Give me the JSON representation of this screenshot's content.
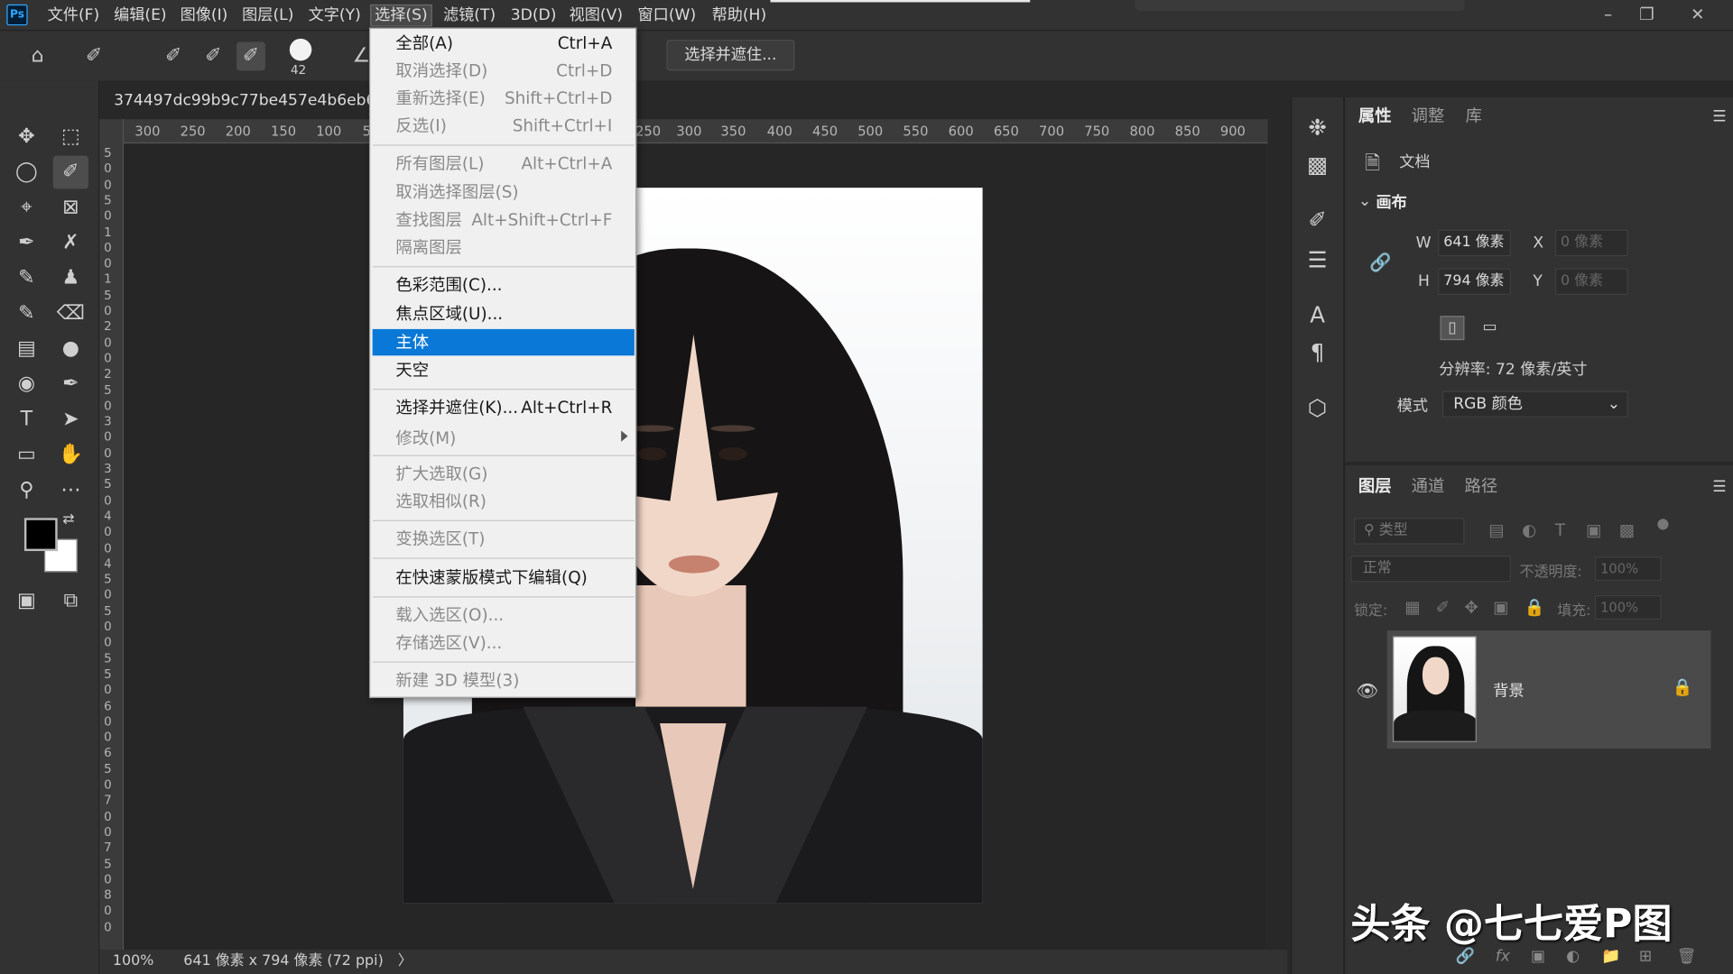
{
  "app": {
    "logo": "Ps"
  },
  "menubar": {
    "items": [
      "文件(F)",
      "编辑(E)",
      "图像(I)",
      "图层(L)",
      "文字(Y)",
      "选择(S)",
      "滤镜(T)",
      "3D(D)",
      "视图(V)",
      "窗口(W)",
      "帮助(H)"
    ],
    "active": "选择(S)"
  },
  "options": {
    "brush_size": "42",
    "select_and_mask": "选择并遮住..."
  },
  "document": {
    "tab_title": "374497dc99b9c77be457e4b6eb606",
    "zoom": "100%",
    "status": "641 像素 x 794 像素 (72 ppi)"
  },
  "ruler": {
    "h_ticks": [
      "300",
      "250",
      "200",
      "150",
      "100",
      "5",
      "250",
      "300",
      "350",
      "400",
      "450",
      "500",
      "550",
      "600",
      "650",
      "700",
      "750",
      "800",
      "850",
      "900"
    ],
    "v_ticks": [
      "5",
      "0",
      "0",
      "5",
      "0",
      "1",
      "0",
      "0",
      "1",
      "5",
      "0",
      "2",
      "0",
      "0",
      "2",
      "5",
      "0",
      "3",
      "0",
      "0",
      "3",
      "5",
      "0",
      "4",
      "0",
      "0",
      "4",
      "5",
      "0",
      "5",
      "0",
      "0",
      "5",
      "5",
      "0",
      "6",
      "0",
      "0",
      "6",
      "5",
      "0",
      "7",
      "0",
      "0",
      "7",
      "5",
      "0",
      "8",
      "0",
      "0"
    ]
  },
  "select_menu": {
    "items": [
      {
        "label": "全部(A)",
        "shortcut": "Ctrl+A",
        "state": "enabled"
      },
      {
        "label": "取消选择(D)",
        "shortcut": "Ctrl+D",
        "state": "disabled"
      },
      {
        "label": "重新选择(E)",
        "shortcut": "Shift+Ctrl+D",
        "state": "disabled"
      },
      {
        "label": "反选(I)",
        "shortcut": "Shift+Ctrl+I",
        "state": "disabled"
      },
      {
        "label": "所有图层(L)",
        "shortcut": "Alt+Ctrl+A",
        "state": "disabled"
      },
      {
        "label": "取消选择图层(S)",
        "shortcut": "",
        "state": "disabled"
      },
      {
        "label": "查找图层",
        "shortcut": "Alt+Shift+Ctrl+F",
        "state": "disabled"
      },
      {
        "label": "隔离图层",
        "shortcut": "",
        "state": "disabled"
      },
      {
        "label": "色彩范围(C)...",
        "shortcut": "",
        "state": "enabled"
      },
      {
        "label": "焦点区域(U)...",
        "shortcut": "",
        "state": "enabled"
      },
      {
        "label": "主体",
        "shortcut": "",
        "state": "highlighted"
      },
      {
        "label": "天空",
        "shortcut": "",
        "state": "enabled"
      },
      {
        "label": "选择并遮住(K)...",
        "shortcut": "Alt+Ctrl+R",
        "state": "enabled"
      },
      {
        "label": "修改(M)",
        "shortcut": "",
        "state": "disabled"
      },
      {
        "label": "扩大选取(G)",
        "shortcut": "",
        "state": "disabled"
      },
      {
        "label": "选取相似(R)",
        "shortcut": "",
        "state": "disabled"
      },
      {
        "label": "变换选区(T)",
        "shortcut": "",
        "state": "disabled"
      },
      {
        "label": "在快速蒙版模式下编辑(Q)",
        "shortcut": "",
        "state": "enabled"
      },
      {
        "label": "载入选区(O)...",
        "shortcut": "",
        "state": "disabled"
      },
      {
        "label": "存储选区(V)...",
        "shortcut": "",
        "state": "disabled"
      },
      {
        "label": "新建 3D 模型(3)",
        "shortcut": "",
        "state": "disabled"
      }
    ]
  },
  "properties": {
    "tabs": [
      "属性",
      "调整",
      "库"
    ],
    "doc_label": "文档",
    "section": "画布",
    "w_label": "W",
    "w_value": "641 像素",
    "h_label": "H",
    "h_value": "794 像素",
    "x_label": "X",
    "x_value": "0 像素",
    "y_label": "Y",
    "y_value": "0 像素",
    "resolution": "分辨率: 72 像素/英寸",
    "mode_label": "模式",
    "mode_value": "RGB 颜色"
  },
  "layers": {
    "tabs": [
      "图层",
      "通道",
      "路径"
    ],
    "filter": "类型",
    "blend_mode": "正常",
    "opacity_label": "不透明度:",
    "opacity_value": "100%",
    "lock_label": "锁定:",
    "fill_label": "填充:",
    "fill_value": "100%",
    "layer_name": "背景"
  },
  "watermark": "头条 @七七爱P图"
}
